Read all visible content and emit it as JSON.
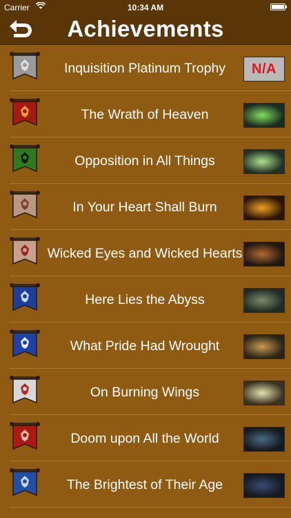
{
  "status_bar": {
    "carrier": "Carrier",
    "time": "10:34 AM",
    "battery": 1.0
  },
  "nav": {
    "title": "Achievements",
    "back_icon": "return-arrow-icon"
  },
  "achievements": [
    {
      "title": "Inquisition Platinum Trophy",
      "thumb": "N/A",
      "banner_color": "#9a9a9a",
      "emblem_color": "#e8e8e8",
      "thumb_colors": [
        "#b9b9b9",
        "#b9b9b9"
      ]
    },
    {
      "title": "The Wrath of Heaven",
      "thumb": "",
      "banner_color": "#a51a12",
      "emblem_color": "#f0b040",
      "thumb_colors": [
        "#1b2a22",
        "#7fe05a"
      ]
    },
    {
      "title": "Opposition in All Things",
      "thumb": "",
      "banner_color": "#2f7a1c",
      "emblem_color": "#111111",
      "thumb_colors": [
        "#203027",
        "#aee08a"
      ]
    },
    {
      "title": "In Your Heart Shall Burn",
      "thumb": "",
      "banner_color": "#b89a84",
      "emblem_color": "#7a3a2a",
      "thumb_colors": [
        "#2a140a",
        "#f0a020"
      ]
    },
    {
      "title": "Wicked Eyes and Wicked Hearts",
      "thumb": "",
      "banner_color": "#c7a08e",
      "emblem_color": "#8c1a1a",
      "thumb_colors": [
        "#201610",
        "#b06a30"
      ]
    },
    {
      "title": "Here Lies the Abyss",
      "thumb": "",
      "banner_color": "#1d3f9c",
      "emblem_color": "#e0e8ff",
      "thumb_colors": [
        "#1e2a24",
        "#7a8a6a"
      ]
    },
    {
      "title": "What Pride Had Wrought",
      "thumb": "",
      "banner_color": "#2040a8",
      "emblem_color": "#ffffff",
      "thumb_colors": [
        "#2a2418",
        "#c89850"
      ]
    },
    {
      "title": "On Burning Wings",
      "thumb": "",
      "banner_color": "#d8d8d8",
      "emblem_color": "#b01010",
      "thumb_colors": [
        "#3a3220",
        "#e6e2b0"
      ]
    },
    {
      "title": "Doom upon All the World",
      "thumb": "",
      "banner_color": "#b01812",
      "emblem_color": "#e8d8c8",
      "thumb_colors": [
        "#141820",
        "#4a6a80"
      ]
    },
    {
      "title": "The Brightest of Their Age",
      "thumb": "",
      "banner_color": "#2050a8",
      "emblem_color": "#e0e8ff",
      "thumb_colors": [
        "#141820",
        "#3a4a70"
      ]
    }
  ]
}
